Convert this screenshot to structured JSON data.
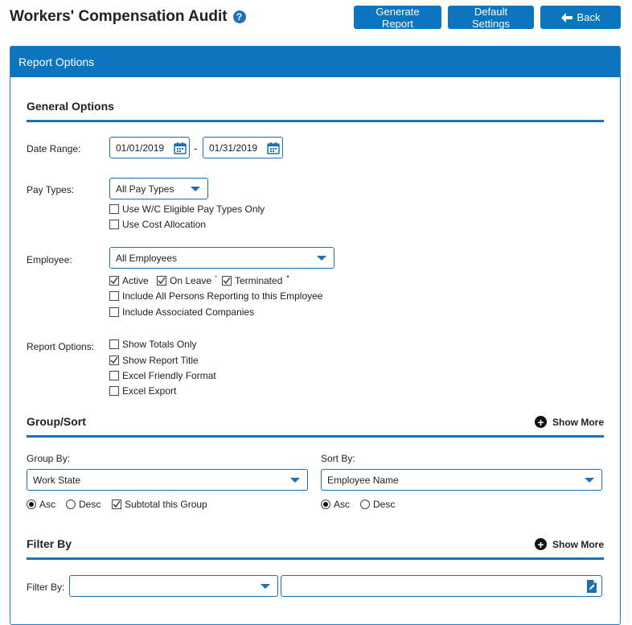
{
  "header": {
    "title": "Workers' Compensation Audit",
    "help_icon": "?",
    "generate_label": "Generate Report",
    "defaults_label": "Default Settings",
    "back_label": "Back"
  },
  "panel": {
    "title": "Report Options"
  },
  "general": {
    "heading": "General Options",
    "date_range_label": "Date Range:",
    "date_from": "01/01/2019",
    "date_sep": "-",
    "date_to": "01/31/2019",
    "pay_types_label": "Pay Types:",
    "pay_types_value": "All Pay Types",
    "wc_eligible_label": "Use W/C Eligible Pay Types Only",
    "cost_allocation_label": "Use Cost Allocation",
    "employee_label": "Employee:",
    "employee_value": "All Employees",
    "active_label": "Active",
    "on_leave_label": "On Leave",
    "terminated_label": "Terminated",
    "include_persons_label": "Include All Persons Reporting to this Employee",
    "include_companies_label": "Include Associated Companies",
    "report_options_label": "Report Options:",
    "show_totals_label": "Show Totals Only",
    "show_title_label": "Show Report Title",
    "excel_friendly_label": "Excel Friendly Format",
    "excel_export_label": "Excel Export"
  },
  "group_sort": {
    "heading": "Group/Sort",
    "show_more": "Show More",
    "group_by_label": "Group By:",
    "group_by_value": "Work State",
    "sort_by_label": "Sort By:",
    "sort_by_value": "Employee Name",
    "asc_label": "Asc",
    "desc_label": "Desc",
    "subtotal_label": "Subtotal this Group"
  },
  "filter": {
    "heading": "Filter By",
    "show_more": "Show More",
    "filter_by_label": "Filter By:",
    "filter_field_value": "",
    "filter_text_value": ""
  },
  "colors": {
    "accent": "#0b75bf",
    "border": "#1f6fb0"
  }
}
